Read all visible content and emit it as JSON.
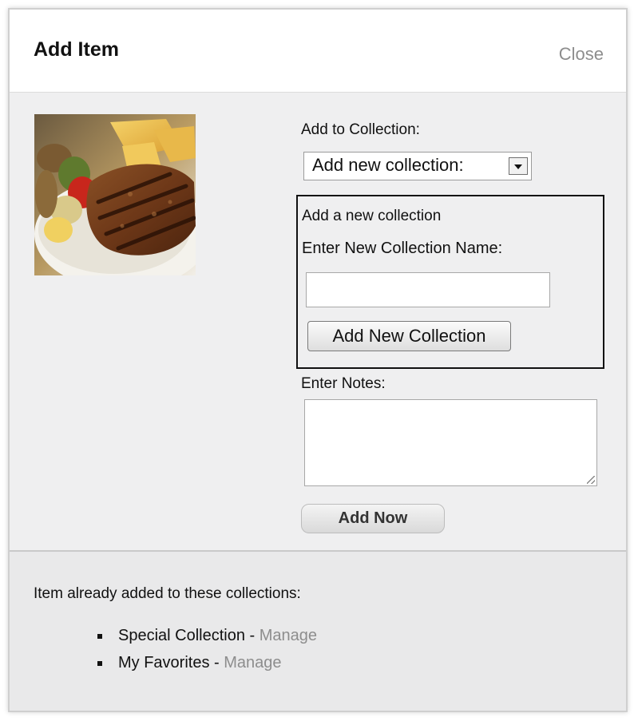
{
  "dialog": {
    "title": "Add Item",
    "close_label": "Close"
  },
  "item": {
    "image": "steak-photo"
  },
  "form": {
    "add_to_collection_label": "Add to Collection:",
    "collection_select": {
      "selected": "Add new collection:"
    },
    "new_collection": {
      "heading": "Add a new collection",
      "name_label": "Enter New Collection Name:",
      "name_value": "",
      "add_button_label": "Add New Collection"
    },
    "notes_label": "Enter Notes:",
    "notes_value": "",
    "add_now_label": "Add Now"
  },
  "footer": {
    "heading": "Item already added to these collections:",
    "collections": [
      {
        "name": "Special Collection",
        "separator": " - ",
        "manage_label": "Manage"
      },
      {
        "name": "My Favorites",
        "separator": " - ",
        "manage_label": "Manage"
      }
    ]
  },
  "colors": {
    "panel_background": "#efeff0",
    "header_background": "#ffffff",
    "footer_background": "#e9e9ea",
    "link_gray": "#8d8d8d"
  }
}
